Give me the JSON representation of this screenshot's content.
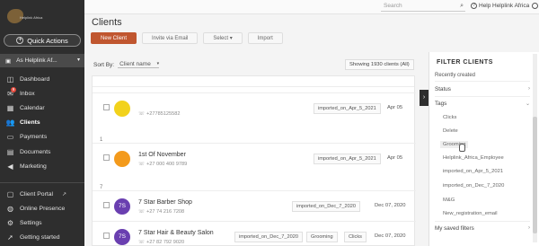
{
  "brand": {
    "logo_text": "Helplink Africa"
  },
  "sidebar": {
    "quick_actions": "Quick Actions",
    "account": "As Helplink Af...",
    "items": [
      {
        "label": "Dashboard",
        "icon": "dashboard-icon"
      },
      {
        "label": "Inbox",
        "icon": "inbox-icon",
        "badge": "9"
      },
      {
        "label": "Calendar",
        "icon": "calendar-icon"
      },
      {
        "label": "Clients",
        "icon": "clients-icon",
        "active": true
      },
      {
        "label": "Payments",
        "icon": "payments-icon"
      },
      {
        "label": "Documents",
        "icon": "documents-icon"
      },
      {
        "label": "Marketing",
        "icon": "marketing-icon"
      }
    ],
    "bottom_items": [
      {
        "label": "Client Portal",
        "icon": "client-portal-icon"
      },
      {
        "label": "Online Presence",
        "icon": "globe-icon"
      },
      {
        "label": "Settings",
        "icon": "gear-icon"
      },
      {
        "label": "Getting started",
        "icon": "rocket-icon"
      }
    ]
  },
  "topbar": {
    "search_placeholder": "Search",
    "help": "Help",
    "user": "Helplink Africa"
  },
  "page": {
    "title": "Clients",
    "buttons": {
      "new_client": "New Client",
      "invite": "Invite via Email",
      "select": "Select",
      "import": "Import"
    },
    "sort_label": "Sort By:",
    "sort_value": "Client name",
    "showing": "Showing 1930 clients (All)"
  },
  "list": {
    "groups": [
      "1",
      "7"
    ],
    "rows": [
      {
        "name": "",
        "phone": "+27785125582",
        "tag": "imported_on_Apr_5_2021",
        "date": "Apr 05",
        "avatar_text": "",
        "avatar_color": "#f2d21c"
      },
      {
        "name": "1st Of November",
        "phone": "+27 000 400 9789",
        "tag": "imported_on_Apr_5_2021",
        "date": "Apr 05",
        "avatar_text": "",
        "avatar_color": "#f39a1c"
      },
      {
        "name": "7 Star Barber Shop",
        "phone": "+27 74 216 7208",
        "tag": "imported_on_Dec_7_2020",
        "date": "Dec 07, 2020",
        "avatar_text": "7S",
        "avatar_color": "#6a3fb0"
      },
      {
        "name": "7 Star Hair & Beauty Salon",
        "phone": "+27 82 792 9020",
        "tags": [
          "imported_on_Dec_7_2020",
          "Grooming",
          "Clicks"
        ],
        "date": "Dec 07, 2020",
        "avatar_text": "7S",
        "avatar_color": "#6a3fb0"
      }
    ]
  },
  "filter": {
    "title": "FILTER CLIENTS",
    "recently_created": "Recently created",
    "status": "Status",
    "tags": "Tags",
    "tag_items": [
      "Clicks",
      "Delete",
      "Grooming",
      "Helplink_Africa_Employee",
      "imported_on_Apr_5_2021",
      "imported_on_Dec_7_2020",
      "M&G",
      "New_registration_email"
    ],
    "saved_filters": "My saved filters"
  }
}
